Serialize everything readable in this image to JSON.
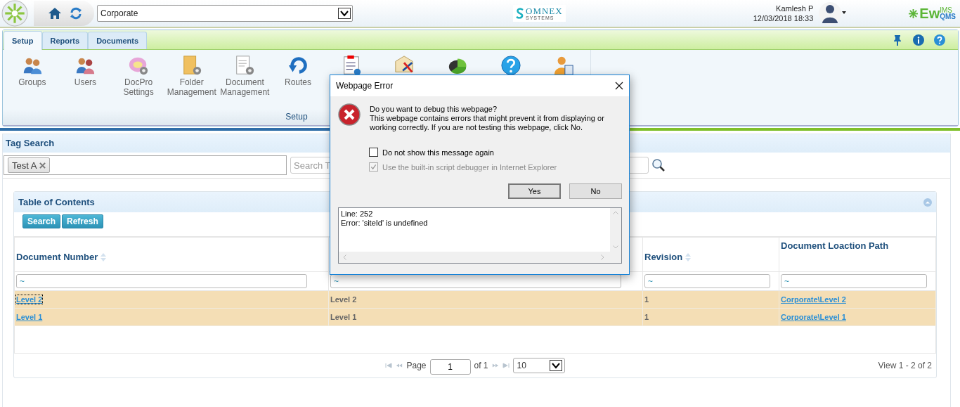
{
  "header": {
    "site_select": "Corporate",
    "logo_text": "OMNEX",
    "logo_subtext": "SYSTEMS",
    "user_name": "Kamlesh P",
    "datetime": "12/03/2018 18:33",
    "brand": "Ew",
    "brand_sup": "IMS",
    "brand_sub": "QMS"
  },
  "tabs": [
    {
      "label": "Setup",
      "selected": true
    },
    {
      "label": "Reports",
      "selected": false
    },
    {
      "label": "Documents",
      "selected": false
    }
  ],
  "ribbon": {
    "items": [
      {
        "kind": "labeled",
        "label": "Groups"
      },
      {
        "kind": "labeled",
        "label": "Users"
      },
      {
        "kind": "labeled",
        "label": "DocPro Settings"
      },
      {
        "kind": "labeled",
        "label": "Folder Management"
      },
      {
        "kind": "labeled",
        "label": "Document Management"
      },
      {
        "kind": "labeled",
        "label": "Routes"
      },
      {
        "kind": "icon_only"
      },
      {
        "kind": "icon_only"
      },
      {
        "kind": "icon_only"
      },
      {
        "kind": "icon_only"
      },
      {
        "kind": "icon_only"
      }
    ],
    "group_label": "Setup"
  },
  "tag_search": {
    "title": "Tag Search",
    "tags": [
      {
        "label": "Test A"
      }
    ],
    "placeholder": "Search T"
  },
  "toc": {
    "title": "Table of Contents",
    "buttons": [
      "Search",
      "Refresh"
    ],
    "columns": [
      {
        "label": "Document Number",
        "sortable": true,
        "filter": "~",
        "kind": "link"
      },
      {
        "filter": "~",
        "kind": "text"
      },
      {
        "label": "Revision",
        "sortable": true,
        "filter": "~",
        "kind": "text"
      },
      {
        "label": "Document Loaction Path",
        "sortable": false,
        "filter": "~",
        "kind": "link"
      }
    ],
    "rows": [
      {
        "cells": [
          "Level 2",
          "Level 2",
          "1",
          "Corporate\\Level 2"
        ],
        "focused": true
      },
      {
        "cells": [
          "Level 1",
          "Level 1",
          "1",
          "Corporate\\Level 1"
        ],
        "focused": false
      }
    ],
    "pager": {
      "page_label": "Page",
      "page": "1",
      "of": "of 1",
      "page_size": "10",
      "summary": "View 1 - 2 of 2"
    }
  },
  "dialog": {
    "title": "Webpage Error",
    "heading": "Do you want to debug this webpage?",
    "message": "This webpage contains errors that might prevent it from displaying or working correctly. If you are not testing this webpage, click No.",
    "checkboxes": [
      {
        "label": "Do not show this message again",
        "checked": false,
        "disabled": false
      },
      {
        "label": "Use the built-in script debugger in Internet Explorer",
        "checked": true,
        "disabled": true
      }
    ],
    "buttons": [
      {
        "label": "Yes",
        "default": true
      },
      {
        "label": "No",
        "default": false
      }
    ],
    "details": [
      "Line: 252",
      "Error: 'siteId' is undefined"
    ]
  }
}
